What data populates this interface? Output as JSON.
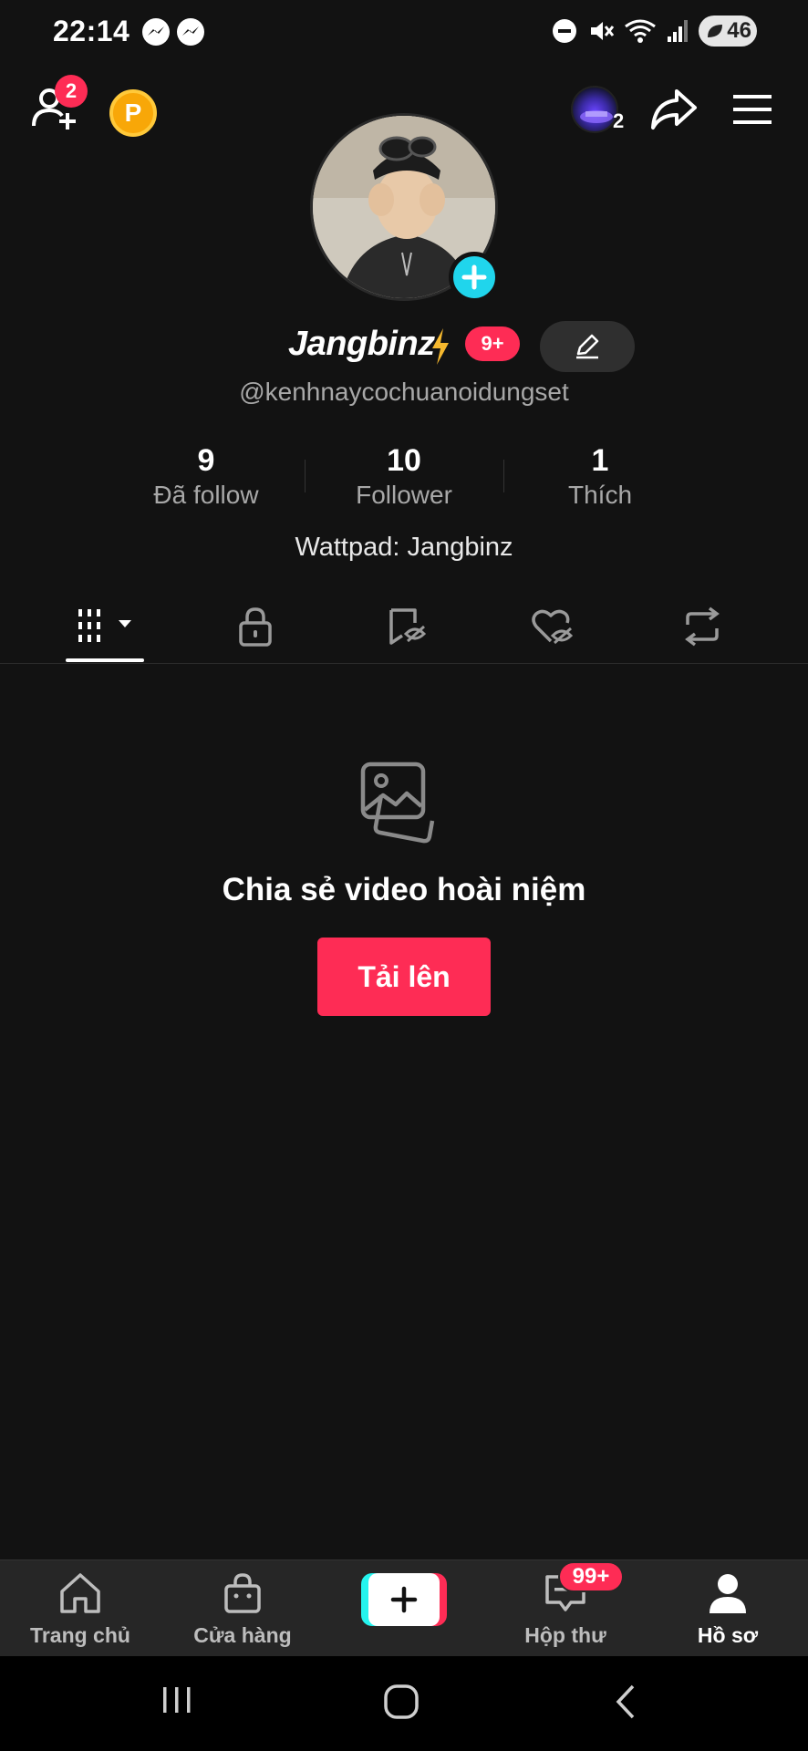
{
  "status_bar": {
    "time": "22:14",
    "battery": "46"
  },
  "top_bar": {
    "friend_requests_count": "2",
    "coin_letter": "P",
    "accounts_count": "2"
  },
  "profile": {
    "username": "Jangbinz",
    "notifications_badge": "9+",
    "handle": "@kenhnaycochuanoidungset",
    "bio": "Wattpad: Jangbinz"
  },
  "stats": {
    "following_count": "9",
    "following_label": "Đã follow",
    "followers_count": "10",
    "followers_label": "Follower",
    "likes_count": "1",
    "likes_label": "Thích"
  },
  "empty_state": {
    "title": "Chia sẻ video hoài niệm",
    "upload_label": "Tải lên"
  },
  "bottom_nav": {
    "home": "Trang chủ",
    "shop": "Cửa hàng",
    "inbox": "Hộp thư",
    "inbox_badge": "99+",
    "profile": "Hồ sơ"
  },
  "colors": {
    "background": "#121212",
    "accent_red": "#fe2c55",
    "accent_cyan": "#20d5ec",
    "coin": "#f8a708"
  }
}
